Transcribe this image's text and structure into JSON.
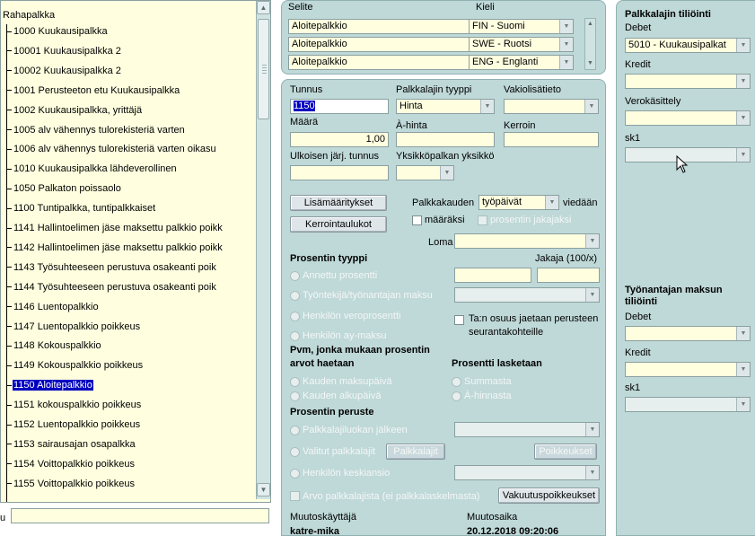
{
  "tree": {
    "root": "Rahapalkka",
    "items": [
      {
        "label": "1000 Kuukausipalkka",
        "selected": false
      },
      {
        "label": "10001 Kuukausipalkka 2",
        "selected": false
      },
      {
        "label": "10002 Kuukausipalkka 2",
        "selected": false
      },
      {
        "label": "1001 Perusteeton etu Kuukausipalkka",
        "selected": false
      },
      {
        "label": "1002 Kuukausipalkka, yrittäjä",
        "selected": false
      },
      {
        "label": "1005 alv vähennys tulorekisteriä varten",
        "selected": false
      },
      {
        "label": "1006 alv vähennys tulorekisteriä varten oikasu",
        "selected": false
      },
      {
        "label": "1010 Kuukausipalkka lähdeverollinen",
        "selected": false
      },
      {
        "label": "1050 Palkaton poissaolo",
        "selected": false
      },
      {
        "label": "1100 Tuntipalkka, tuntipalkkaiset",
        "selected": false
      },
      {
        "label": "1141 Hallintoelimen jäse maksettu palkkio poikk",
        "selected": false
      },
      {
        "label": "1142 Hallintoelimen jäse maksettu palkkio poikk",
        "selected": false
      },
      {
        "label": "1143 Työsuhteeseen perustuva osakeanti poik",
        "selected": false
      },
      {
        "label": "1144 Työsuhteeseen perustuva osakeanti poik",
        "selected": false
      },
      {
        "label": "1146 Luentopalkkio",
        "selected": false
      },
      {
        "label": "1147 Luentopalkkio poikkeus",
        "selected": false
      },
      {
        "label": "1148 Kokouspalkkio",
        "selected": false
      },
      {
        "label": "1149 Kokouspalkkio poikkeus",
        "selected": false
      },
      {
        "label": "1150 Aloitepalkkio",
        "selected": true
      },
      {
        "label": "1151 kokouspalkkio poikkeus",
        "selected": false
      },
      {
        "label": "1152 Luentopalkkio poikkeus",
        "selected": false
      },
      {
        "label": "1153 sairausajan osapalkka",
        "selected": false
      },
      {
        "label": "1154 Voittopalkkio poikkeus",
        "selected": false
      },
      {
        "label": "1155 Voittopalkkio poikkeus",
        "selected": false
      }
    ]
  },
  "filter": {
    "label": "u",
    "value": ""
  },
  "selite": {
    "selite_label": "Selite",
    "kieli_label": "Kieli",
    "rows": [
      {
        "text": "Aloitepalkkio",
        "lang": "FIN - Suomi"
      },
      {
        "text": "Aloitepalkkio",
        "lang": "SWE - Ruotsi"
      },
      {
        "text": "Aloitepalkkio",
        "lang": "ENG - Englanti"
      }
    ]
  },
  "main": {
    "tunnus_label": "Tunnus",
    "tunnus_value": "1150",
    "tyyppi_label": "Palkkalajin tyyppi",
    "tyyppi_value": "Hinta",
    "vakio_label": "Vakiolisätieto",
    "vakio_value": "",
    "maara_label": "Määrä",
    "maara_value": "1,00",
    "ahinta_label": "À-hinta",
    "ahinta_value": "",
    "kerroin_label": "Kerroin",
    "kerroin_value": "",
    "ulk_label": "Ulkoisen järj. tunnus",
    "ulk_value": "",
    "yks_label": "Yksikköpalkan yksikkö",
    "yks_value": "",
    "btn_lisa": "Lisämääritykset",
    "btn_kerroin": "Kerrointaulukot",
    "palkkakausi_label": "Palkkakauden",
    "palkkakausi_value": "työpäivät",
    "viedaan_label": "viedään",
    "maaraksi_label": "määräksi",
    "prosentin_jakajaksi_label": "prosentin jakajaksi",
    "loma_label": "Loma",
    "loma_value": "",
    "prosentin_tyyppi_label": "Prosentin tyyppi",
    "jakaja_label": "Jakaja (100/x)",
    "r_annettu": "Annettu prosentti",
    "r_tyontekija": "Työntekijä/työnantajan maksu",
    "r_veroprosentti": "Henkilön veroprosentti",
    "r_aymaksu": "Henkilön ay-maksu",
    "ta_osuus_label": "Ta:n osuus jaetaan perusteen seurantakohteille",
    "pvm_label": "Pvm, jonka mukaan prosentin arvot haetaan",
    "r_maksupaiva": "Kauden maksupäivä",
    "r_alkupaiva": "Kauden alkupäivä",
    "prosentti_lasketaan_label": "Prosentti lasketaan",
    "r_summasta": "Summasta",
    "r_ahinnasta": "À-hinnasta",
    "peruste_label": "Prosentin peruste",
    "r_palkkalajiluokan": "Palkkalajiluokan jälkeen",
    "r_valitut": "Valitut palkkalajit",
    "btn_palkkalajit": "Palkkalajit",
    "btn_poikkeukset": "Poikkeukset",
    "r_kesk": "Henkilön keskiansio",
    "arvo_label": "Arvo palkkalajista (ei palkkalaskelmasta)",
    "btn_vakuutus": "Vakuutuspoikkeukset",
    "muutoskayttaja_label": "Muutoskäyttäjä",
    "muutoskayttaja_value": "katre-mika",
    "muutosaika_label": "Muutosaika",
    "muutosaika_value": "20.12.2018 09:20:06"
  },
  "right": {
    "title": "Palkkalajin tiliöinti",
    "debet_label": "Debet",
    "debet_value": "5010 - Kuukausipalkat",
    "kredit_label": "Kredit",
    "kredit_value": "",
    "vero_label": "Verokäsittely",
    "vero_value": "",
    "sk1_label": "sk1",
    "sk1_value": "",
    "tyonantaja_title": "Työnantajan maksun tiliöinti",
    "debet2_label": "Debet",
    "debet2_value": "",
    "kredit2_label": "Kredit",
    "kredit2_value": "",
    "sk1b_label": "sk1",
    "sk1b_value": ""
  }
}
